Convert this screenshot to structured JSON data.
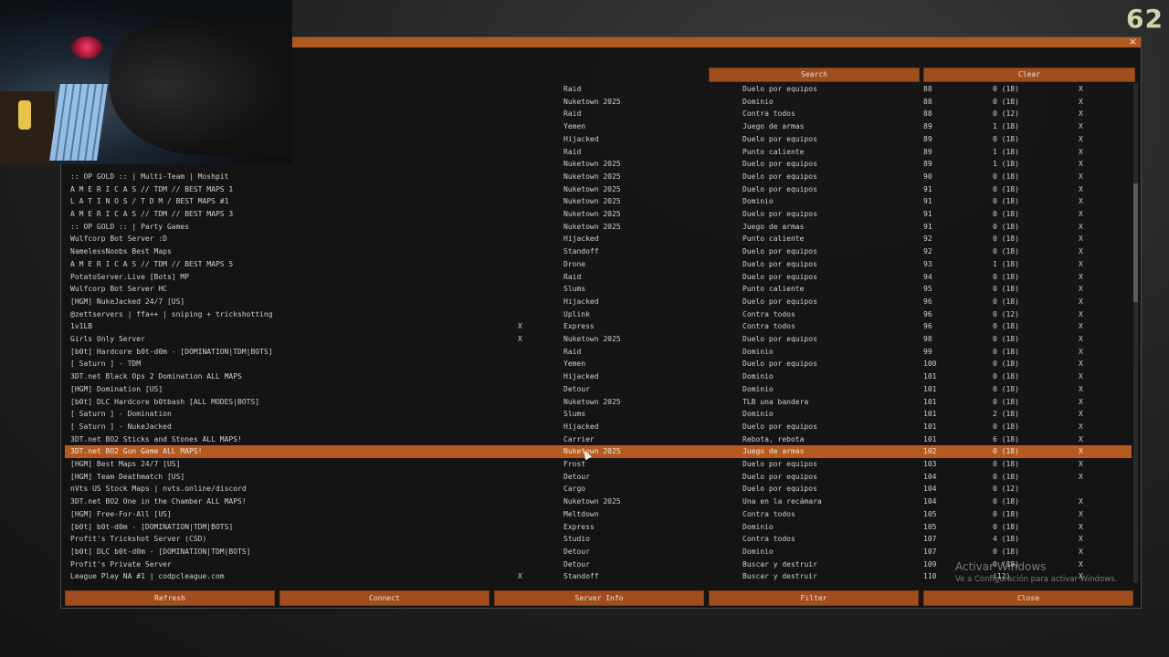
{
  "window": {
    "close_label": "×"
  },
  "overlay": {
    "fps": "62"
  },
  "toolbar": {
    "search_label": "Search",
    "clear_label": "Clear"
  },
  "servers": [
    {
      "name": "",
      "pw": "",
      "map": "Raid",
      "mode": "Duelo por equipos",
      "ping": "88",
      "players": "0 (18)",
      "x": "X"
    },
    {
      "name": "",
      "pw": "",
      "map": "Nuketown 2025",
      "mode": "Dominio",
      "ping": "88",
      "players": "0 (18)",
      "x": "X"
    },
    {
      "name": "",
      "pw": "",
      "map": "Raid",
      "mode": "Contra todos",
      "ping": "88",
      "players": "0 (12)",
      "x": "X"
    },
    {
      "name": "",
      "pw": "",
      "map": "Yemen",
      "mode": "Juego de armas",
      "ping": "89",
      "players": "1 (18)",
      "x": "X"
    },
    {
      "name": "",
      "pw": "",
      "map": "Hijacked",
      "mode": "Duelo por equipos",
      "ping": "89",
      "players": "0 (18)",
      "x": "X"
    },
    {
      "name": "",
      "pw": "",
      "map": "Raid",
      "mode": "Punto caliente",
      "ping": "89",
      "players": "1 (18)",
      "x": "X"
    },
    {
      "name": "",
      "pw": "",
      "map": "Nuketown 2025",
      "mode": "Duelo por equipos",
      "ping": "89",
      "players": "1 (18)",
      "x": "X"
    },
    {
      "name": ":: OP GOLD :: | Multi-Team | Moshpit",
      "pw": "",
      "map": "Nuketown 2025",
      "mode": "Duelo por equipos",
      "ping": "90",
      "players": "0 (18)",
      "x": "X"
    },
    {
      "name": "A M E R I C A S // TDM // BEST MAPS 1",
      "pw": "",
      "map": "Nuketown 2025",
      "mode": "Duelo por equipos",
      "ping": "91",
      "players": "0 (18)",
      "x": "X"
    },
    {
      "name": "L A T I N O S / T D M / BEST MAPS #1",
      "pw": "",
      "map": "Nuketown 2025",
      "mode": "Dominio",
      "ping": "91",
      "players": "0 (18)",
      "x": "X"
    },
    {
      "name": "A M E R I C A S // TDM // BEST MAPS 3",
      "pw": "",
      "map": "Nuketown 2025",
      "mode": "Duelo por equipos",
      "ping": "91",
      "players": "0 (18)",
      "x": "X"
    },
    {
      "name": ":: OP GOLD :: | Party Games",
      "pw": "",
      "map": "Nuketown 2025",
      "mode": "Juego de armas",
      "ping": "91",
      "players": "0 (18)",
      "x": "X"
    },
    {
      "name": "Wulfcorp Bot Server :D",
      "pw": "",
      "map": "Hijacked",
      "mode": "Punto caliente",
      "ping": "92",
      "players": "0 (18)",
      "x": "X"
    },
    {
      "name": "NamelessNoobs Best Maps",
      "pw": "",
      "map": "Standoff",
      "mode": "Duelo por equipos",
      "ping": "92",
      "players": "0 (18)",
      "x": "X"
    },
    {
      "name": "A M E R I C A S // TDM // BEST MAPS 5",
      "pw": "",
      "map": "Drone",
      "mode": "Duelo por equipos",
      "ping": "93",
      "players": "1 (18)",
      "x": "X"
    },
    {
      "name": "PotatoServer.Live [Bots] MP",
      "pw": "",
      "map": "Raid",
      "mode": "Duelo por equipos",
      "ping": "94",
      "players": "0 (18)",
      "x": "X"
    },
    {
      "name": "Wulfcorp Bot Server HC",
      "pw": "",
      "map": "Slums",
      "mode": "Punto caliente",
      "ping": "95",
      "players": "0 (18)",
      "x": "X"
    },
    {
      "name": "[HGM] NukeJacked 24/7 [US]",
      "pw": "",
      "map": "Hijacked",
      "mode": "Duelo por equipos",
      "ping": "96",
      "players": "0 (18)",
      "x": "X"
    },
    {
      "name": "@zettservers | ffa++ | sniping + trickshotting",
      "pw": "",
      "map": "Uplink",
      "mode": "Contra todos",
      "ping": "96",
      "players": "0 (12)",
      "x": "X"
    },
    {
      "name": "1v1LB",
      "pw": "X",
      "map": "Express",
      "mode": "Contra todos",
      "ping": "96",
      "players": "0 (18)",
      "x": "X"
    },
    {
      "name": "Girls Only Server",
      "pw": "X",
      "map": "Nuketown 2025",
      "mode": "Duelo por equipos",
      "ping": "98",
      "players": "0 (18)",
      "x": "X"
    },
    {
      "name": "[b0t] Hardcore b0t-d0m - [DOMINATION|TDM|BOTS]",
      "pw": "",
      "map": "Raid",
      "mode": "Dominio",
      "ping": "99",
      "players": "0 (18)",
      "x": "X"
    },
    {
      "name": "[ Saturn ] - TDM",
      "pw": "",
      "map": "Yemen",
      "mode": "Duelo por equipos",
      "ping": "100",
      "players": "0 (18)",
      "x": "X"
    },
    {
      "name": "3DT.net Black Ops 2 Domination ALL MAPS",
      "pw": "",
      "map": "Hijacked",
      "mode": "Dominio",
      "ping": "101",
      "players": "0 (18)",
      "x": "X"
    },
    {
      "name": "[HGM] Domination [US]",
      "pw": "",
      "map": "Detour",
      "mode": "Dominio",
      "ping": "101",
      "players": "0 (18)",
      "x": "X"
    },
    {
      "name": "[b0t] DLC Hardcore b0tbash [ALL MODES|BOTS]",
      "pw": "",
      "map": "Nuketown 2025",
      "mode": "TLB una bandera",
      "ping": "101",
      "players": "0 (18)",
      "x": "X"
    },
    {
      "name": "[ Saturn ] - Domination",
      "pw": "",
      "map": "Slums",
      "mode": "Dominio",
      "ping": "101",
      "players": "2 (18)",
      "x": "X"
    },
    {
      "name": "[ Saturn ] - NukeJacked",
      "pw": "",
      "map": "Hijacked",
      "mode": "Duelo por equipos",
      "ping": "101",
      "players": "0 (18)",
      "x": "X"
    },
    {
      "name": "3DT.net BO2 Sticks and Stones ALL MAPS!",
      "pw": "",
      "map": "Carrier",
      "mode": "Rebota, rebota",
      "ping": "101",
      "players": "6 (18)",
      "x": "X"
    },
    {
      "name": "3DT.net BO2 Gun Game ALL MAPS!",
      "pw": "",
      "map": "Nuketown 2025",
      "mode": "Juego de armas",
      "ping": "102",
      "players": "0 (18)",
      "x": "X",
      "selected": true
    },
    {
      "name": "[HGM] Best Maps 24/7 [US]",
      "pw": "",
      "map": "Frost",
      "mode": "Duelo por equipos",
      "ping": "103",
      "players": "0 (18)",
      "x": "X"
    },
    {
      "name": "[HGM] Team Deathmatch [US]",
      "pw": "",
      "map": "Detour",
      "mode": "Duelo por equipos",
      "ping": "104",
      "players": "0 (18)",
      "x": "X"
    },
    {
      "name": "nVts US Stock Maps | nvts.online/discord",
      "pw": "",
      "map": "Cargo",
      "mode": "Duelo por equipos",
      "ping": "104",
      "players": "0 (12)",
      "x": ""
    },
    {
      "name": "3DT.net BO2 One in the Chamber ALL MAPS!",
      "pw": "",
      "map": "Nuketown 2025",
      "mode": "Una en la recámara",
      "ping": "104",
      "players": "0 (18)",
      "x": "X"
    },
    {
      "name": "[HGM] Free-For-All [US]",
      "pw": "",
      "map": "Meltdown",
      "mode": "Contra todos",
      "ping": "105",
      "players": "0 (18)",
      "x": "X"
    },
    {
      "name": "[b0t] b0t-d0m - [DOMINATION|TDM|BOTS]",
      "pw": "",
      "map": "Express",
      "mode": "Dominio",
      "ping": "105",
      "players": "0 (18)",
      "x": "X"
    },
    {
      "name": "Profit's Trickshot Server (CSD)",
      "pw": "",
      "map": "Studio",
      "mode": "Contra todos",
      "ping": "107",
      "players": "4 (18)",
      "x": "X"
    },
    {
      "name": "[b0t] DLC b0t-d0m - [DOMINATION|TDM|BOTS]",
      "pw": "",
      "map": "Detour",
      "mode": "Dominio",
      "ping": "107",
      "players": "0 (18)",
      "x": "X"
    },
    {
      "name": "Profit's Private Server",
      "pw": "",
      "map": "Detour",
      "mode": "Buscar y destruir",
      "ping": "109",
      "players": "0 (18)",
      "x": "X"
    },
    {
      "name": "League Play NA #1 | codpcleague.com",
      "pw": "X",
      "map": "Standoff",
      "mode": "Buscar y destruir",
      "ping": "110",
      "players": "(12)",
      "x": "X"
    }
  ],
  "buttons": {
    "refresh": "Refresh",
    "connect": "Connect",
    "server_info": "Server Info",
    "filter": "Filter",
    "close": "Close"
  },
  "watermark": {
    "line1": "Activar Windows",
    "line2": "Ve a Configuración para activar Windows."
  },
  "colors": {
    "accent": "#b05a22",
    "selected_row": "#b75a20"
  }
}
